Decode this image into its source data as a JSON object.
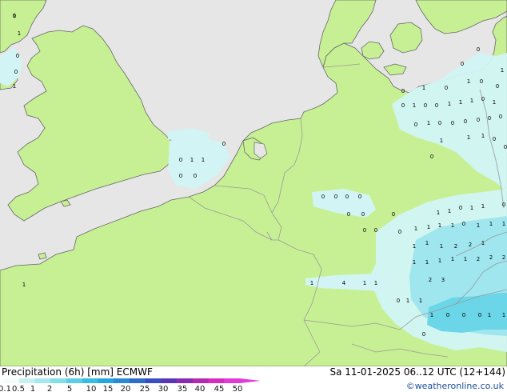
{
  "title_left": "Precipitation (6h) [mm] ECMWF",
  "title_right": "Sa 11-01-2025 06..12 UTC (12+144)",
  "credit": "©weatheronline.co.uk",
  "legend": {
    "ticks": [
      "0.1",
      "0.5",
      "1",
      "2",
      "5",
      "10",
      "15",
      "20",
      "25",
      "30",
      "35",
      "40",
      "45",
      "50"
    ],
    "colors": [
      "#f4fcfc",
      "#c8f0f0",
      "#a6e8ee",
      "#84dfea",
      "#5ccfe6",
      "#38bce2",
      "#26a6dc",
      "#2a8ad4",
      "#2e6ccc",
      "#3a4ec2",
      "#5a36b6",
      "#8a2ab0",
      "#b428b2",
      "#d62cc4",
      "#e23ad8"
    ]
  },
  "colors": {
    "land": "#c7f095",
    "sea": "#e6e6e6",
    "border": "#9a9a9a",
    "coast": "#666666"
  },
  "rain_values": [
    {
      "v": "1"
    },
    {
      "v": "1"
    },
    {
      "v": "0"
    },
    {
      "v": "0"
    },
    {
      "v": "1"
    },
    {
      "v": "0"
    },
    {
      "v": "0"
    },
    {
      "v": "0"
    },
    {
      "v": "1"
    },
    {
      "v": "0"
    },
    {
      "v": "1"
    },
    {
      "v": "0"
    },
    {
      "v": "0"
    },
    {
      "v": "1"
    },
    {
      "v": "0"
    },
    {
      "v": "0"
    },
    {
      "v": "1"
    },
    {
      "v": "1"
    },
    {
      "v": "1"
    },
    {
      "v": "0"
    },
    {
      "v": "1"
    },
    {
      "v": "0"
    },
    {
      "v": "1"
    },
    {
      "v": "0"
    },
    {
      "v": "0"
    },
    {
      "v": "0"
    },
    {
      "v": "0"
    },
    {
      "v": "0"
    },
    {
      "v": "0"
    },
    {
      "v": "0"
    },
    {
      "v": "1"
    },
    {
      "v": "1"
    },
    {
      "v": "1"
    },
    {
      "v": "1"
    },
    {
      "v": "0"
    },
    {
      "v": "0"
    },
    {
      "v": "0"
    },
    {
      "v": "0"
    },
    {
      "v": "1"
    },
    {
      "v": "1"
    },
    {
      "v": "0"
    },
    {
      "v": "0"
    },
    {
      "v": "0"
    },
    {
      "v": "0"
    },
    {
      "v": "0"
    },
    {
      "v": "0"
    },
    {
      "v": "0"
    },
    {
      "v": "0"
    },
    {
      "v": "0"
    },
    {
      "v": "0"
    },
    {
      "v": "1"
    },
    {
      "v": "1"
    },
    {
      "v": "0"
    },
    {
      "v": "1"
    },
    {
      "v": "1"
    },
    {
      "v": "0"
    },
    {
      "v": "0"
    },
    {
      "v": "0"
    },
    {
      "v": "0"
    },
    {
      "v": "1"
    },
    {
      "v": "1"
    },
    {
      "v": "1"
    },
    {
      "v": "1"
    },
    {
      "v": "0"
    },
    {
      "v": "1"
    },
    {
      "v": "1"
    },
    {
      "v": "1"
    },
    {
      "v": "1"
    },
    {
      "v": "1"
    },
    {
      "v": "1"
    },
    {
      "v": "2"
    },
    {
      "v": "2"
    },
    {
      "v": "1"
    },
    {
      "v": "1"
    },
    {
      "v": "1"
    },
    {
      "v": "1"
    },
    {
      "v": "1"
    },
    {
      "v": "1"
    },
    {
      "v": "2"
    },
    {
      "v": "2"
    },
    {
      "v": "2"
    },
    {
      "v": "2"
    },
    {
      "v": "3"
    },
    {
      "v": "4"
    },
    {
      "v": "1"
    },
    {
      "v": "1"
    },
    {
      "v": "1"
    },
    {
      "v": "1"
    },
    {
      "v": "1"
    },
    {
      "v": "1"
    },
    {
      "v": "0"
    },
    {
      "v": "1"
    },
    {
      "v": "0"
    },
    {
      "v": "0"
    },
    {
      "v": "0"
    },
    {
      "v": "1"
    },
    {
      "v": "1"
    },
    {
      "v": "0"
    },
    {
      "v": "0"
    }
  ]
}
